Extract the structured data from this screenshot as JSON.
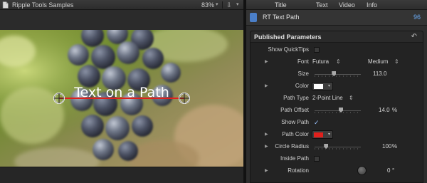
{
  "viewer": {
    "title": "Ripple Tools Samples",
    "zoom": "83%",
    "dropdown_glyph": "▾",
    "switch_glyph": "⇩",
    "canvas_text": "Text on a Path"
  },
  "inspector": {
    "tabs": [
      "Title",
      "Text",
      "Video",
      "Info"
    ],
    "clip_name": "RT Text Path",
    "duration": "96",
    "group_title": "Published Parameters",
    "reset_glyph": "↶",
    "params": {
      "show_quicktips": {
        "label": "Show QuickTips",
        "checked": false
      },
      "font": {
        "label": "Font",
        "family": "Futura",
        "weight": "Medium"
      },
      "size": {
        "label": "Size",
        "value": "113.0",
        "slider_fraction": 0.42
      },
      "color": {
        "label": "Color",
        "swatch": "#ffffff"
      },
      "path_type": {
        "label": "Path Type",
        "value": "2-Point Line"
      },
      "path_offset": {
        "label": "Path Offset",
        "value": "14.0",
        "unit": "%",
        "slider_fraction": 0.57
      },
      "show_path": {
        "label": "Show Path",
        "checked": true
      },
      "path_color": {
        "label": "Path Color",
        "swatch": "#e0201c"
      },
      "circle_radius": {
        "label": "Circle Radius",
        "value": "100",
        "unit": "%",
        "slider_fraction": 0.25
      },
      "inside_path": {
        "label": "Inside Path",
        "checked": false
      },
      "rotation": {
        "label": "Rotation",
        "value": "0",
        "unit": "°"
      }
    },
    "glyphs": {
      "updown": "⇕",
      "expand": "▶",
      "check": "✓",
      "dropdown": "▾"
    }
  },
  "colors": {
    "accent_blue": "#6aaaf5",
    "path_red": "#e0201c"
  }
}
